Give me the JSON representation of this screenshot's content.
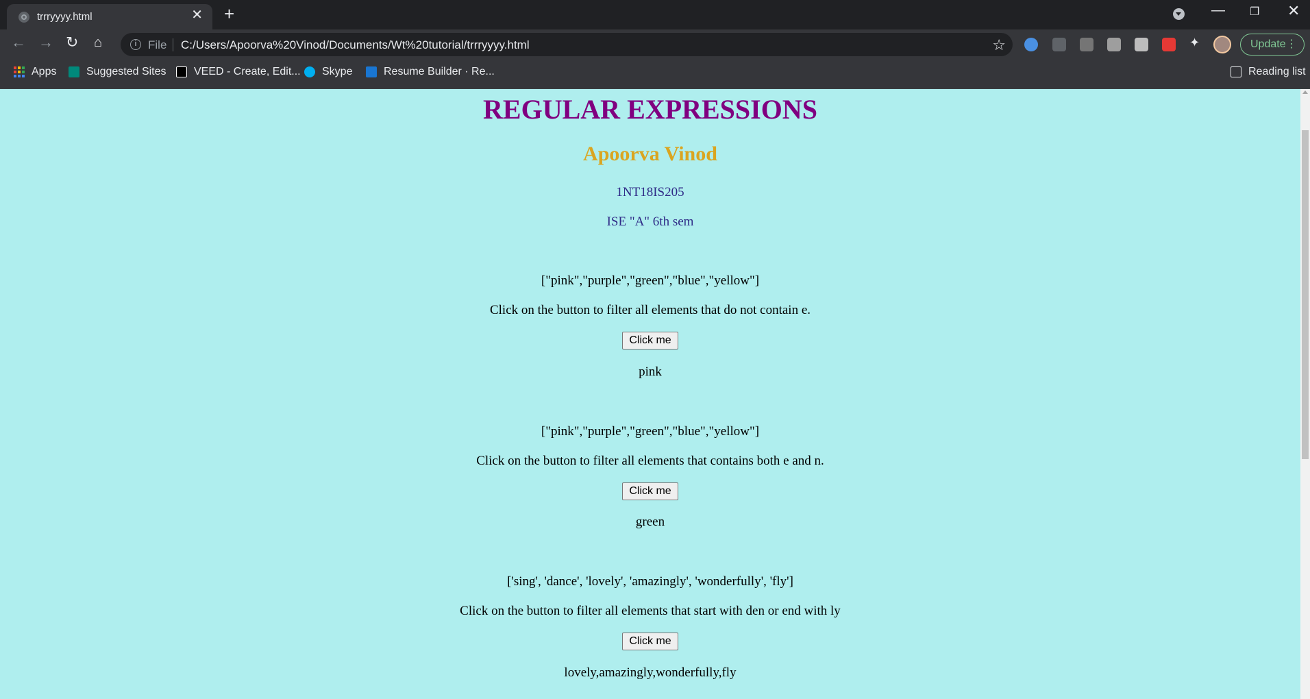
{
  "browser": {
    "tab_title": "trrryyyy.html",
    "tab_close": "✕",
    "new_tab": "+",
    "omnibox_scheme": "File",
    "url": "C:/Users/Apoorva%20Vinod/Documents/Wt%20tutorial/trrryyyy.html",
    "update_label": "Update",
    "bookmarks": [
      "Apps",
      "Suggested Sites",
      "VEED - Create, Edit...",
      "Skype",
      "Resume Builder · Re..."
    ],
    "reading_list": "Reading list"
  },
  "page": {
    "title": "REGULAR EXPRESSIONS",
    "name": "Apoorva Vinod",
    "usn": "1NT18IS205",
    "class": "ISE \"A\" 6th sem",
    "sections": [
      {
        "array": "[\"pink\",\"purple\",\"green\",\"blue\",\"yellow\"]",
        "instruction": "Click on the button to filter all elements that do not contain e.",
        "button": "Click me",
        "result": "pink"
      },
      {
        "array": "[\"pink\",\"purple\",\"green\",\"blue\",\"yellow\"]",
        "instruction": "Click on the button to filter all elements that contains both e and n.",
        "button": "Click me",
        "result": "green"
      },
      {
        "array": "['sing', 'dance', 'lovely', 'amazingly', 'wonderfully', 'fly']",
        "instruction": "Click on the button to filter all elements that start with den or end with ly",
        "button": "Click me",
        "result": "lovely,amazingly,wonderfully,fly"
      }
    ]
  },
  "colors": {
    "page_background": "#afeeee",
    "title": "#800080",
    "name": "#daa520",
    "info": "#2f2a87"
  }
}
